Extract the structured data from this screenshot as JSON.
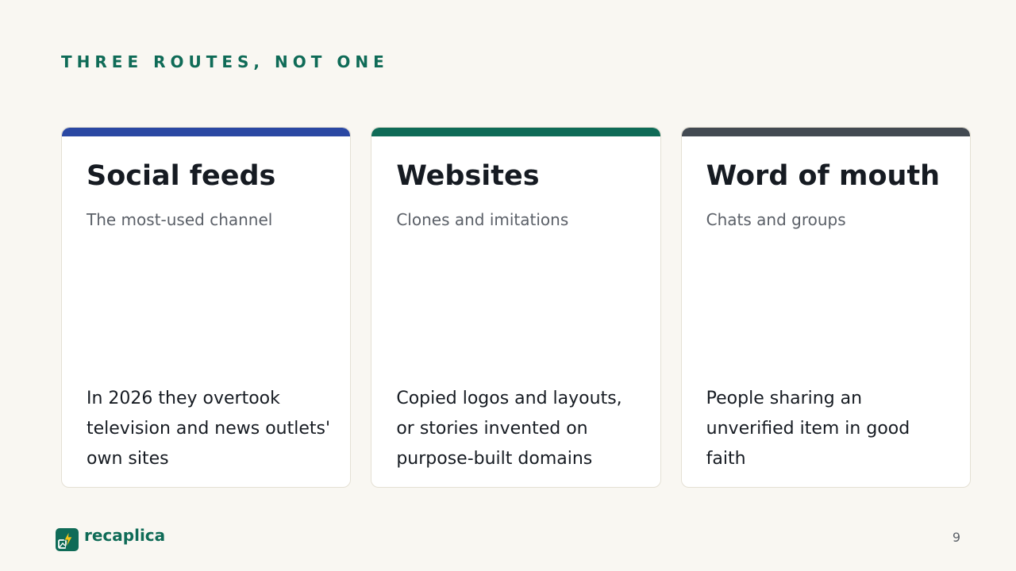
{
  "slide": {
    "eyebrow": "THREE ROUTES, NOT ONE",
    "page_number": "9"
  },
  "cards": [
    {
      "title": "Social feeds",
      "subtitle": "The most-used channel",
      "body": "In 2026 they overtook television and news outlets' own sites",
      "accent": "#2b48a3"
    },
    {
      "title": "Websites",
      "subtitle": "Clones and imitations",
      "body": "Copied logos and layouts, or stories invented on purpose-built domains",
      "accent": "#0f6b57"
    },
    {
      "title": "Word of mouth",
      "subtitle": "Chats and groups",
      "body": "People sharing an unverified item in good faith",
      "accent": "#434a52"
    }
  ],
  "footer": {
    "brand": "recaplica",
    "logo_icon": "lightning-image-icon"
  },
  "colors": {
    "background": "#f9f7f2",
    "brand_green": "#0f6b57",
    "text_dark": "#161b22",
    "text_muted": "#5b6068"
  }
}
